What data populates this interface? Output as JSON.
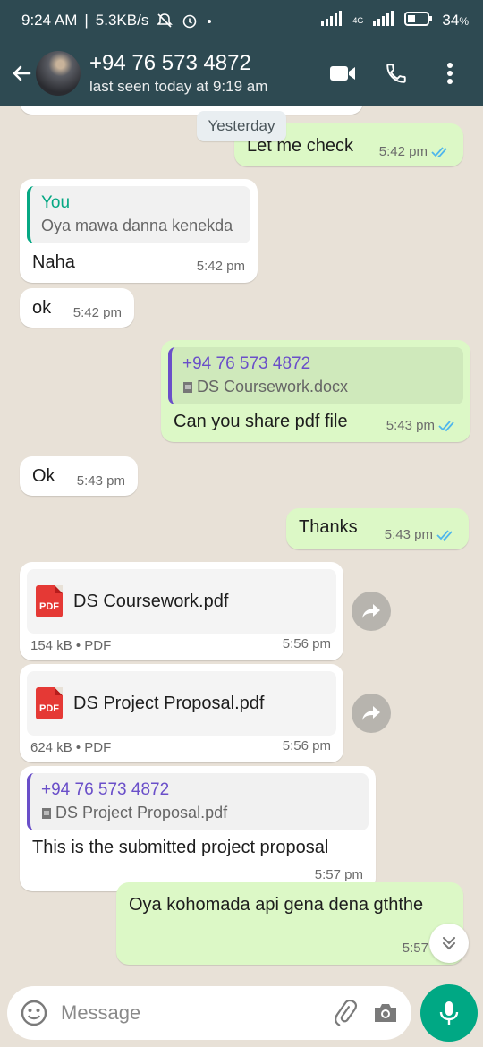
{
  "status_bar": {
    "time": "9:24 AM",
    "speed": "5.3KB/s",
    "network": "4G",
    "battery": "34"
  },
  "header": {
    "contact_name": "+94 76 573 4872",
    "last_seen": "last seen today at 9:19 am"
  },
  "chat": {
    "date_chip": "Yesterday",
    "messages": [
      {
        "text": "Let me check",
        "time": "5:42 pm"
      },
      {
        "quote_author": "You",
        "quote_text": "Oya mawa danna kenekda",
        "text": "Naha",
        "time": "5:42 pm"
      },
      {
        "text": "ok",
        "time": "5:42 pm"
      },
      {
        "quote_author": "+94 76 573 4872",
        "quote_text": "DS Coursework.docx",
        "text": "Can you share pdf file",
        "time": "5:43 pm"
      },
      {
        "text": "Ok",
        "time": "5:43 pm"
      },
      {
        "text": "Thanks",
        "time": "5:43 pm"
      },
      {
        "doc_name": "DS Coursework.pdf",
        "doc_meta": "154 kB • PDF",
        "time": "5:56 pm",
        "icon_label": "PDF"
      },
      {
        "doc_name": "DS Project Proposal.pdf",
        "doc_meta": "624 kB • PDF",
        "time": "5:56 pm",
        "icon_label": "PDF"
      },
      {
        "quote_author": "+94 76 573 4872",
        "quote_text": "DS Project Proposal.pdf",
        "text": "This is the submitted project proposal",
        "time": "5:57 pm"
      },
      {
        "text": "Oya kohomada api gena dena gththe",
        "time": "5:57 pm"
      }
    ]
  },
  "input": {
    "placeholder": "Message"
  },
  "colors": {
    "header_bg": "#2e4a52",
    "outgoing_bubble": "#dcf8c6",
    "incoming_bubble": "#ffffff",
    "accent_green": "#00a884",
    "read_ticks": "#4fb6ec"
  }
}
